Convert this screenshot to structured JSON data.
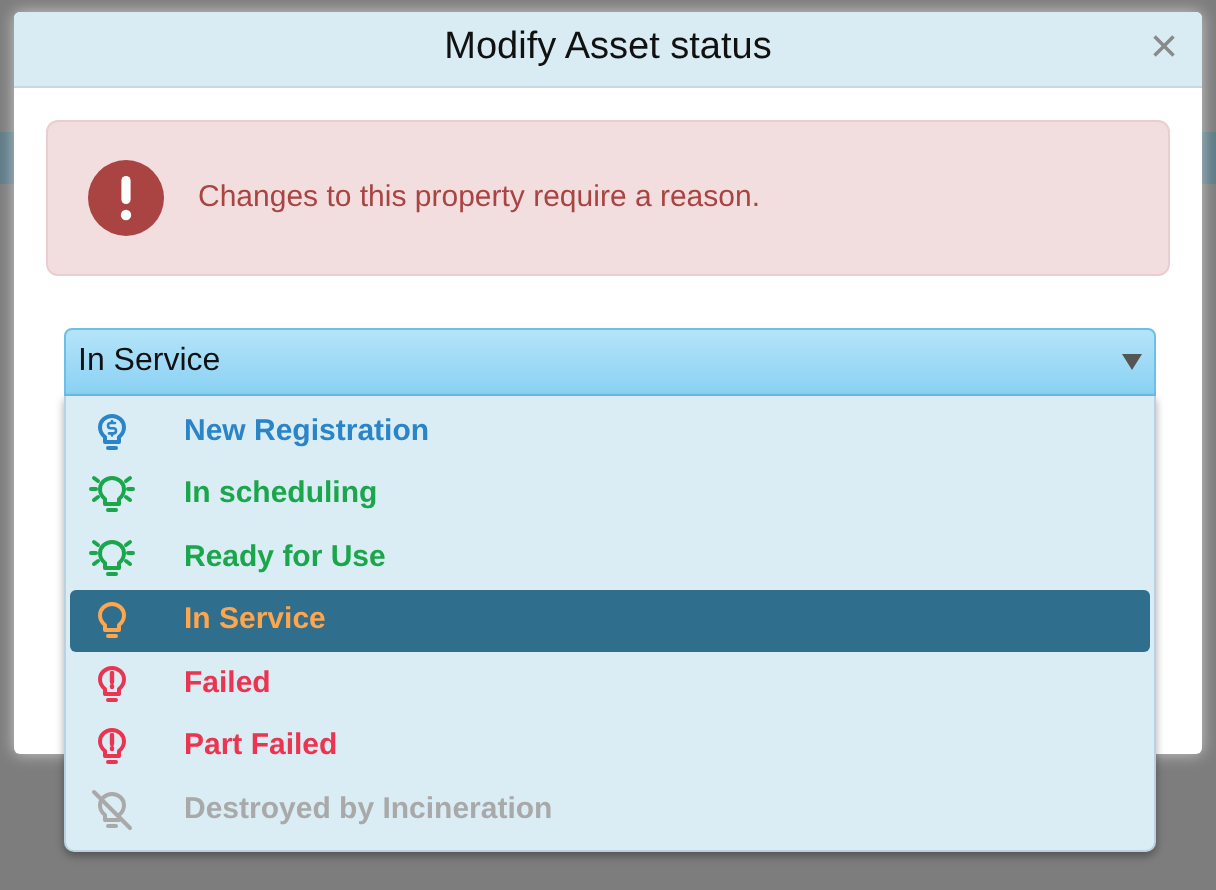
{
  "dialog": {
    "title": "Modify Asset status",
    "close": "×",
    "alert": {
      "message": "Changes to this property require a reason."
    },
    "select": {
      "value": "In Service",
      "expanded": true,
      "options": [
        {
          "label": "New Registration",
          "kind": "dollar",
          "color": "#2a84c8",
          "selected": false
        },
        {
          "label": "In scheduling",
          "kind": "rays",
          "color": "#1aa64b",
          "selected": false
        },
        {
          "label": "Ready for Use",
          "kind": "rays",
          "color": "#1aa64b",
          "selected": false
        },
        {
          "label": "In Service",
          "kind": "plain",
          "color": "#ffa64d",
          "selected": true
        },
        {
          "label": "Failed",
          "kind": "alert",
          "color": "#ea3450",
          "selected": false
        },
        {
          "label": "Part Failed",
          "kind": "alert",
          "color": "#ea3450",
          "selected": false
        },
        {
          "label": "Destroyed by Incineration",
          "kind": "off",
          "color": "#a9a9a9",
          "selected": false
        }
      ]
    }
  }
}
